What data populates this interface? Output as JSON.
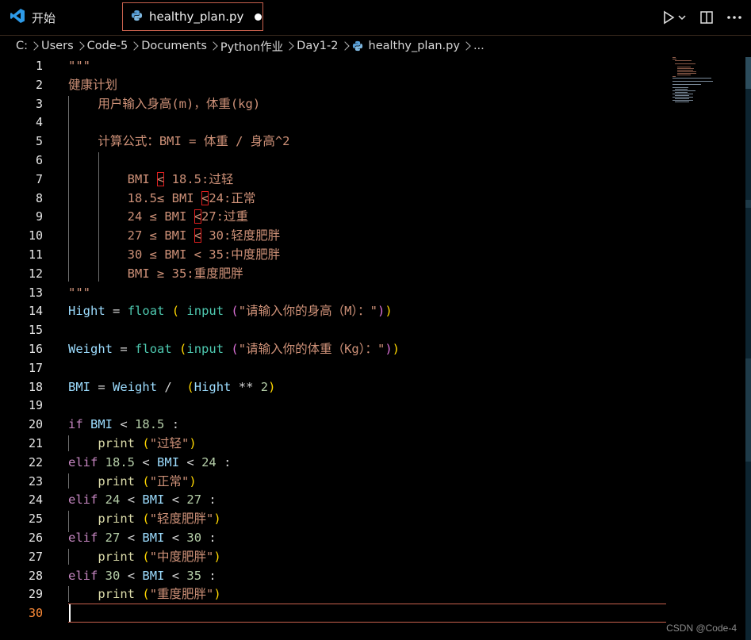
{
  "tabs": {
    "welcome": "开始",
    "file": "healthy_plan.py"
  },
  "icons": {
    "app": "vscode-icon",
    "python": "python-file-icon",
    "run": "play-icon",
    "run_dropdown": "chevron-down-icon",
    "split": "split-editor-icon",
    "more": "more-actions-icon"
  },
  "breadcrumb": [
    "C:",
    "Users",
    "Code-5",
    "Documents",
    "Python作业",
    "Day1-2",
    "healthy_plan.py",
    "..."
  ],
  "editor": {
    "active_line": 30,
    "line_numbers": [
      "1",
      "2",
      "3",
      "4",
      "5",
      "6",
      "7",
      "8",
      "9",
      "10",
      "11",
      "12",
      "13",
      "14",
      "15",
      "16",
      "17",
      "18",
      "19",
      "20",
      "21",
      "22",
      "23",
      "24",
      "25",
      "26",
      "27",
      "28",
      "29",
      "30"
    ],
    "lines": [
      "\"\"\"",
      "健康计划",
      "    用户输入身高(m)，体重(kg)",
      "",
      "    计算公式：BMI = 体重 / 身高^2",
      "",
      "        BMI < 18.5:过轻",
      "        18.5≤ BMI <24:正常",
      "        24 ≤ BMI <27:过重",
      "        27 ≤ BMI < 30:轻度肥胖",
      "        30 ≤ BMI < 35:中度肥胖",
      "        BMI ≥ 35:重度肥胖",
      "\"\"\"",
      "Hight = float ( input (\"请输入你的身高（M）：\"))",
      "",
      "Weight = float (input (\"请输入你的体重（Kg）：\"))",
      "",
      "BMI = Weight /  (Hight ** 2)",
      "",
      "if BMI < 18.5 :",
      "    print (\"过轻\")",
      "elif 18.5 < BMI < 24 :",
      "    print (\"正常\")",
      "elif 24 < BMI < 27 :",
      "    print (\"轻度肥胖\")",
      "elif 27 < BMI < 30 :",
      "    print (\"中度肥胖\")",
      "elif 30 < BMI < 35 :",
      "    print (\"重度肥胖\")",
      ""
    ]
  },
  "colors": {
    "string": "#ce9178",
    "variable": "#9cdcfe",
    "function": "#dcdcaa",
    "builtin": "#4ec9b0",
    "keyword": "#c586c0",
    "number": "#b5cea8",
    "active_line_number": "#ff8c38",
    "tab_border": "#c8614d",
    "annotation_box": "#e02020"
  },
  "watermark": "CSDN @Code-4"
}
